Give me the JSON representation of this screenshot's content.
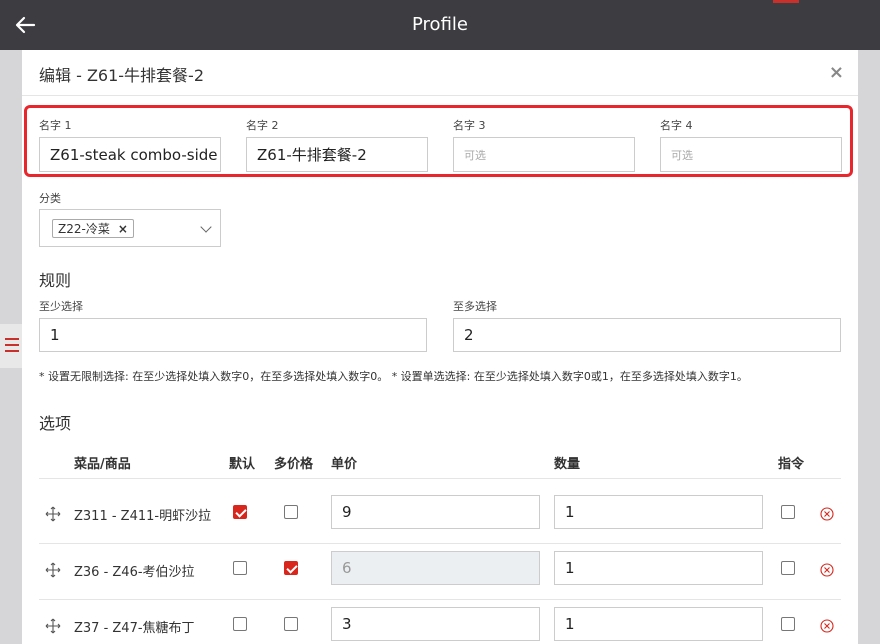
{
  "topbar": {
    "title": "Profile",
    "back_icon": "arrow-left-icon"
  },
  "modal": {
    "title": "编辑 - Z61-牛排套餐-2",
    "close": "×",
    "names": [
      {
        "label": "名字 1",
        "value": "Z61-steak combo-side",
        "placeholder": ""
      },
      {
        "label": "名字 2",
        "value": "Z61-牛排套餐-2",
        "placeholder": ""
      },
      {
        "label": "名字 3",
        "value": "",
        "placeholder": "可选"
      },
      {
        "label": "名字 4",
        "value": "",
        "placeholder": "可选"
      }
    ],
    "category": {
      "label": "分类",
      "tag": "Z22-冷菜",
      "tag_remove": "×"
    },
    "rules": {
      "title": "规则",
      "min_label": "至少选择",
      "min_value": "1",
      "max_label": "至多选择",
      "max_value": "2",
      "note": "* 设置无限制选择: 在至少选择处填入数字0，在至多选择处填入数字0。 * 设置单选选择: 在至少选择处填入数字0或1，在至多选择处填入数字1。"
    },
    "options": {
      "title": "选项",
      "headers": {
        "item": "菜品/商品",
        "default": "默认",
        "multi_price": "多价格",
        "price": "单价",
        "qty": "数量",
        "command": "指令"
      },
      "rows": [
        {
          "name": "Z311 - Z411-明虾沙拉",
          "default": true,
          "multi_price": false,
          "price": "9",
          "price_disabled": false,
          "qty": "1",
          "command": false
        },
        {
          "name": "Z36 - Z46-考伯沙拉",
          "default": false,
          "multi_price": true,
          "price": "6",
          "price_disabled": true,
          "qty": "1",
          "command": false
        },
        {
          "name": "Z37 - Z47-焦糖布丁",
          "default": false,
          "multi_price": false,
          "price": "3",
          "price_disabled": false,
          "qty": "1",
          "command": false
        }
      ]
    }
  },
  "colors": {
    "accent": "#d9261c",
    "highlight": "#e8262c",
    "topbar": "#3c3c41"
  }
}
